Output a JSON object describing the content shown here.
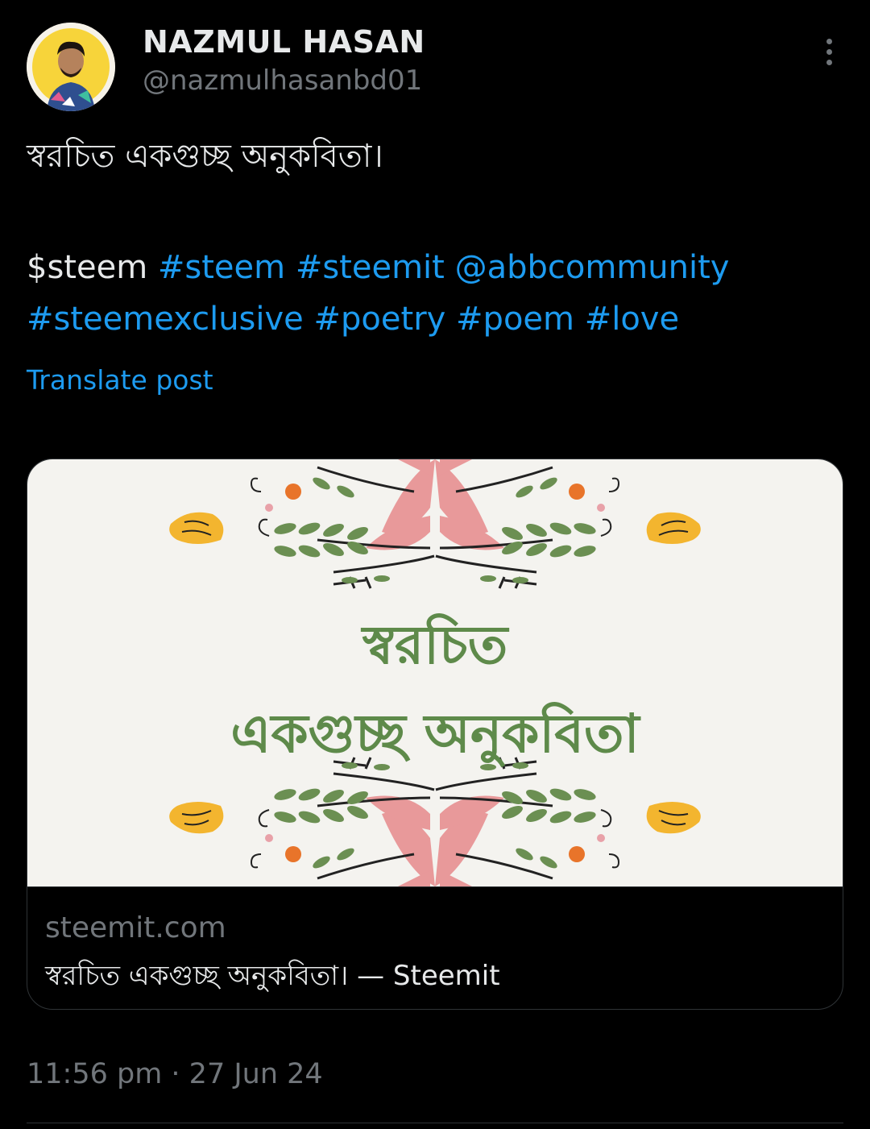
{
  "author": {
    "name": "NAZMUL HASAN",
    "handle": "@nazmulhasanbd01"
  },
  "tweet": {
    "line1": "স্বরচিত একগুচ্ছ অনুকবিতা।",
    "cashtag": "$steem",
    "tags_line1": [
      "#steem",
      "#steemit",
      "@abbcommunity"
    ],
    "tags_line2": [
      "#steemexclusive",
      "#poetry",
      "#poem",
      "#love"
    ],
    "translate_label": "Translate post"
  },
  "card": {
    "image_title_line1": "স্বরচিত",
    "image_title_line2": "একগুচ্ছ অনুকবিতা",
    "domain": "steemit.com",
    "title": "স্বরচিত একগুচ্ছ অনুকবিতা। — Steemit"
  },
  "timestamp": "11:56 pm · 27 Jun 24",
  "colors": {
    "background": "#000000",
    "text": "#e7e9ea",
    "muted": "#71767b",
    "link": "#1d9bf0",
    "card_title_green": "#5e8a4a",
    "petal_pink": "#e8999a",
    "leaf_green": "#6b8f52",
    "flower_yellow": "#f3b52f",
    "flower_orange": "#e8742a"
  },
  "icons": {
    "more": "more-vertical-icon"
  }
}
